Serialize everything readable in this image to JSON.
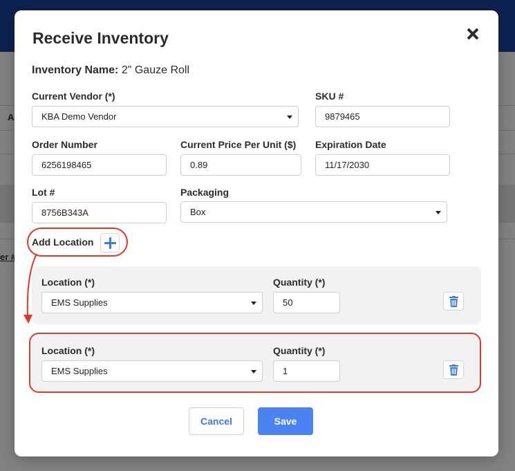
{
  "background": {
    "partial_texts": [
      "A",
      "er #"
    ]
  },
  "modal": {
    "title": "Receive Inventory",
    "inventory_name_label": "Inventory Name:",
    "inventory_name_value": "2\" Gauze Roll",
    "fields": {
      "current_vendor": {
        "label": "Current Vendor (*)",
        "value": "KBA Demo Vendor"
      },
      "sku": {
        "label": "SKU #",
        "value": "9879465"
      },
      "order_number": {
        "label": "Order Number",
        "value": "6256198465"
      },
      "price_per_unit": {
        "label": "Current Price Per Unit ($)",
        "value": "0.89"
      },
      "expiration_date": {
        "label": "Expiration Date",
        "value": "11/17/2030"
      },
      "lot": {
        "label": "Lot #",
        "value": "8756B343A"
      },
      "packaging": {
        "label": "Packaging",
        "value": "Box"
      }
    },
    "add_location_label": "Add Location",
    "locations": [
      {
        "location_label": "Location (*)",
        "location_value": "EMS Supplies",
        "quantity_label": "Quantity (*)",
        "quantity_value": "50"
      },
      {
        "location_label": "Location (*)",
        "location_value": "EMS Supplies",
        "quantity_label": "Quantity (*)",
        "quantity_value": "1"
      }
    ],
    "buttons": {
      "cancel": "Cancel",
      "save": "Save"
    }
  },
  "colors": {
    "accent": "#4b83f2",
    "annotation": "#e5362a",
    "header": "#0d2250"
  },
  "icons": [
    "close-icon",
    "plus-icon",
    "trash-icon",
    "caret-down-icon"
  ]
}
